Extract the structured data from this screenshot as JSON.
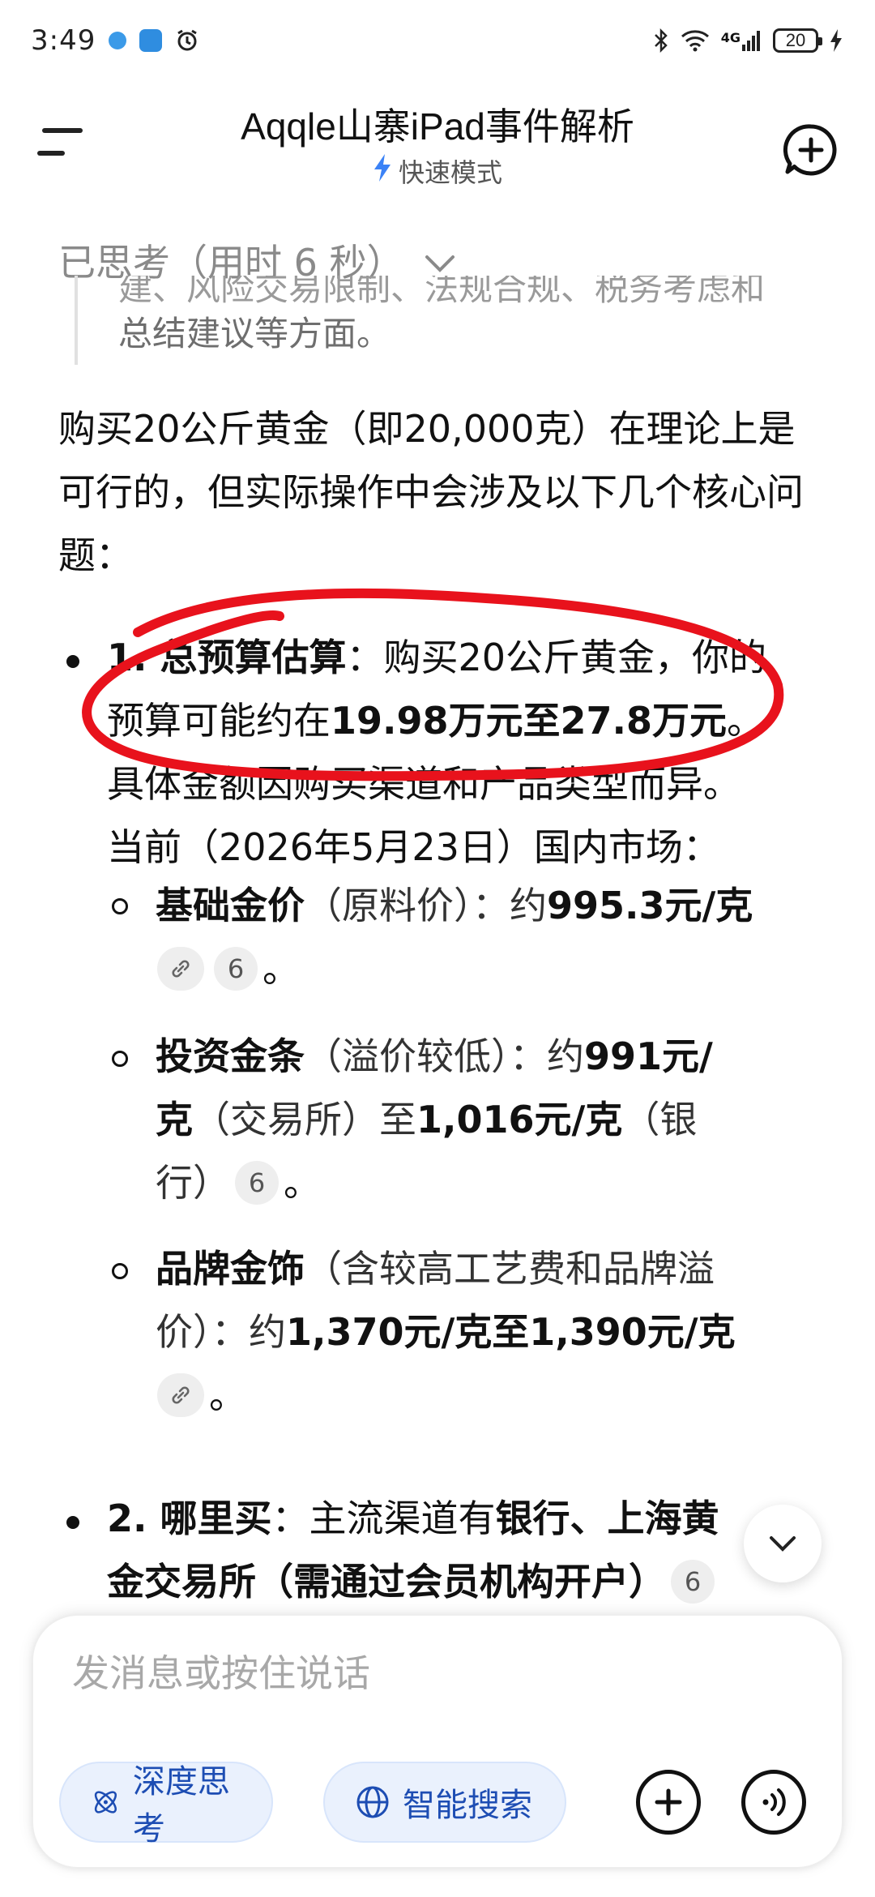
{
  "status_bar": {
    "time": "3:49",
    "network": "4G",
    "battery": "20"
  },
  "header": {
    "title": "Aqqle山寨iPad事件解析",
    "mode": "快速模式"
  },
  "thinking": {
    "header": "已思考（用时 6 秒）",
    "cut_line": "建、风险交易限制、法规合规、税务考虑和",
    "tail_line": "总结建议等方面。"
  },
  "intro": "购买20公斤黄金（即20,000克）在理论上是可行的，但实际操作中会涉及以下几个核心问题：",
  "section1": {
    "l1_bold": "1. 总预算估算",
    "l1_text": "：购买20公斤黄金，你的",
    "l2_text": "预算可能约在",
    "l2_bold": "19.98万元至27.8万元",
    "l2_end": "。",
    "l3_text": "具体金额因购买渠道和产品类型而异。",
    "l4_text": "当前（2026年5月23日）国内市场："
  },
  "sub1": {
    "bold1": "基础金价",
    "text1": "（原料价）：约",
    "bold2": "995.3元/克",
    "chip": "6",
    "end": "。"
  },
  "sub2": {
    "bold1": "投资金条",
    "text1": "（溢价较低）：约",
    "bold2": "991元/",
    "bold3": "克",
    "text2": "（交易所）至",
    "bold4": "1,016元/克",
    "text3": "（银",
    "text4": "行）",
    "chip": "6",
    "end": "。"
  },
  "sub3": {
    "bold1": "品牌金饰",
    "text1": "（含较高工艺费和品牌溢",
    "text2": "价）：约",
    "bold2": "1,370元/克至1,390元/克",
    "end": "。"
  },
  "section2": {
    "l1_bold": "2. 哪里买",
    "l1_text": "：主流渠道有",
    "l1_bold2": "银行、上海黄",
    "l2_bold": "金交易所（需通过会员机构开户）",
    "chip": "6"
  },
  "composer": {
    "placeholder": "发消息或按住说话",
    "deep_label": "深度思考",
    "search_label": "智能搜索"
  },
  "colors": {
    "accent": "#1d4db3",
    "pill_bg": "#eaf1fd",
    "annotation": "#e8121c",
    "bolt": "#3b82f6"
  }
}
